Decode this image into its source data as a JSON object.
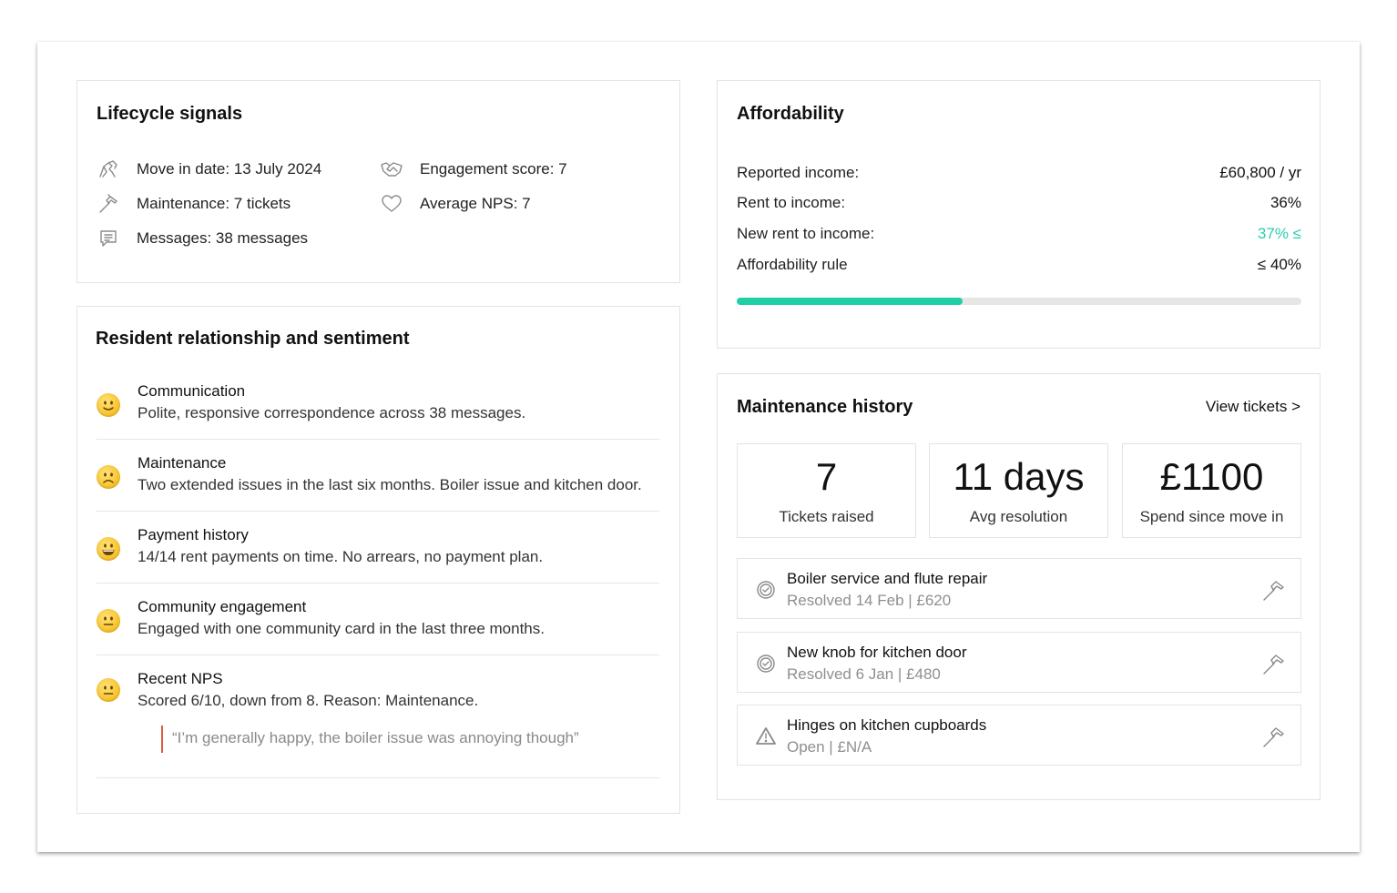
{
  "lifecycle": {
    "title": "Lifecycle signals",
    "signals": [
      {
        "icon": "move-in-icon",
        "text": "Move in date: 13 July 2024"
      },
      {
        "icon": "maintenance-hammer-icon",
        "text": "Maintenance: 7 tickets"
      },
      {
        "icon": "message-icon",
        "text": "Messages: 38 messages"
      },
      {
        "icon": "engagement-handshake-icon",
        "text": "Engagement score: 7"
      },
      {
        "icon": "heart-icon",
        "text": "Average NPS: 7"
      }
    ]
  },
  "resident": {
    "title": "Resident relationship and sentiment",
    "rows": [
      {
        "mood": "slight-smile-emoji",
        "heading": "Communication",
        "detail": "Polite, responsive correspondence across 38 messages."
      },
      {
        "mood": "frown-emoji",
        "heading": "Maintenance",
        "detail": "Two extended issues in the last six months. Boiler issue and kitchen door."
      },
      {
        "mood": "grin-emoji",
        "heading": "Payment history",
        "detail": "14/14 rent payments on time. No arrears, no payment plan."
      },
      {
        "mood": "neutral-emoji",
        "heading": "Community engagement",
        "detail": "Engaged with one community card in the last three months."
      },
      {
        "mood": "neutral-emoji",
        "heading": "Recent NPS",
        "detail": "Scored 6/10, down from 8. Reason: Maintenance."
      }
    ],
    "quote": "“I’m generally happy, the boiler issue was annoying though”"
  },
  "affordability": {
    "title": "Affordability",
    "rows": [
      {
        "label": "Reported income:",
        "value": "£60,800 / yr"
      },
      {
        "label": "Rent to income:",
        "value": "36%"
      },
      {
        "label": "New rent to income:",
        "value": "37% ≤"
      },
      {
        "label": "Affordability rule",
        "value": "≤ 40%"
      }
    ],
    "highlight_color": "#2ccdaf",
    "progress_fraction": 0.4
  },
  "maintenance": {
    "title": "Maintenance history",
    "view_link": "View tickets >",
    "stats": [
      {
        "value": "7",
        "label": "Tickets raised"
      },
      {
        "value": "11 days",
        "label": "Avg resolution"
      },
      {
        "value": "£1100",
        "label": "Spend since move in"
      }
    ],
    "tickets": [
      {
        "status_icon": "resolved-check-icon",
        "title": "Boiler service and flute repair",
        "sub": "Resolved 14 Feb | £620"
      },
      {
        "status_icon": "resolved-check-icon",
        "title": "New knob for kitchen door",
        "sub": "Resolved 6 Jan | £480"
      },
      {
        "status_icon": "warning-triangle-icon",
        "title": "Hinges on kitchen cupboards",
        "sub": "Open | £N/A"
      }
    ]
  }
}
